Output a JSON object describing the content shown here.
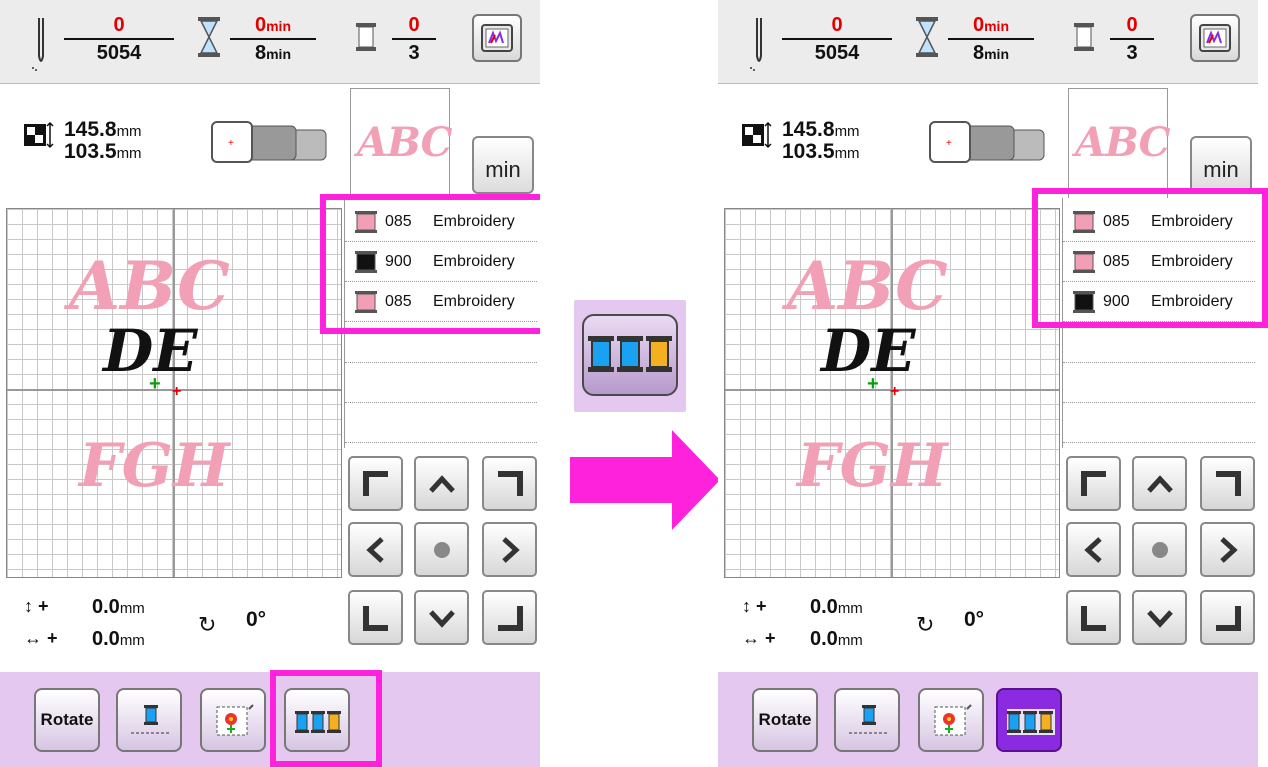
{
  "left": {
    "stitch": {
      "current": "0",
      "total": "5054"
    },
    "time": {
      "current": "0",
      "total": "8",
      "unit": "min"
    },
    "thread_changes": {
      "current": "0",
      "total": "3"
    },
    "size": {
      "width": "145.8",
      "height": "103.5",
      "unit": "mm"
    },
    "preview_text": "ABC",
    "min_label": "min",
    "threads": [
      {
        "code": "085",
        "name": "Embroidery",
        "color": "#f29fb6"
      },
      {
        "code": "900",
        "name": "Embroidery",
        "color": "#111111"
      },
      {
        "code": "085",
        "name": "Embroidery",
        "color": "#f29fb6"
      }
    ],
    "design_lines": [
      "ABC",
      "DE",
      "FGH"
    ],
    "position": {
      "vertical": "0.0",
      "horizontal": "0.0",
      "unit": "mm",
      "plus": "+"
    },
    "angle": "0°",
    "rotate_label": "Rotate"
  },
  "right": {
    "stitch": {
      "current": "0",
      "total": "5054"
    },
    "time": {
      "current": "0",
      "total": "8",
      "unit": "min"
    },
    "thread_changes": {
      "current": "0",
      "total": "3"
    },
    "size": {
      "width": "145.8",
      "height": "103.5",
      "unit": "mm"
    },
    "preview_text": "ABC",
    "min_label": "min",
    "threads": [
      {
        "code": "085",
        "name": "Embroidery",
        "color": "#f29fb6"
      },
      {
        "code": "085",
        "name": "Embroidery",
        "color": "#f29fb6"
      },
      {
        "code": "900",
        "name": "Embroidery",
        "color": "#111111"
      }
    ],
    "design_lines": [
      "ABC",
      "DE",
      "FGH"
    ],
    "position": {
      "vertical": "0.0",
      "horizontal": "0.0",
      "unit": "mm",
      "plus": "+"
    },
    "angle": "0°",
    "rotate_label": "Rotate"
  },
  "icons": {
    "needle": "needle-icon",
    "hourglass": "hourglass-icon",
    "spool": "thread-spool-icon",
    "monitor": "embroidery-monitor-icon",
    "color_sort": "color-sort-icon",
    "arrow": "right-arrow-icon"
  },
  "colors": {
    "highlight": "#ff22dd",
    "bottom_bar": "#e4c8ef",
    "red": "#e30000",
    "pink_thread": "#f29fb6"
  }
}
